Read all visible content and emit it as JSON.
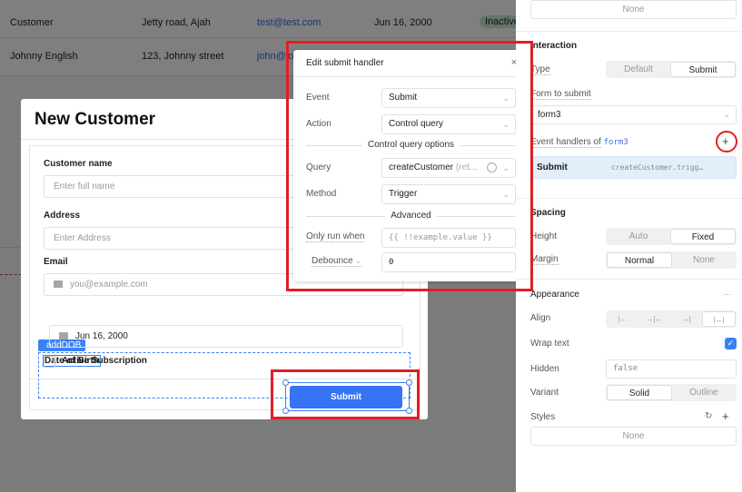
{
  "background_table": {
    "rows": [
      {
        "name": "Customer",
        "address": "Jetty road, Ajah",
        "email": "test@test.com",
        "dob": "Jun 16, 2000",
        "status": "Inactive"
      },
      {
        "name": "Johnny English",
        "address": "123, Johnny street",
        "email": "john@jo",
        "dob": "",
        "status": ""
      }
    ]
  },
  "modal": {
    "title": "New Customer",
    "fields": {
      "customer_name": {
        "label": "Customer name",
        "placeholder": "Enter full name"
      },
      "address": {
        "label": "Address",
        "placeholder": "Enter Address"
      },
      "email": {
        "label": "Email",
        "placeholder": "you@example.com"
      },
      "dob": {
        "tag": "addDOB",
        "label": "Date of Birth",
        "value": "Jun 16, 2000"
      },
      "active": {
        "label": "Active Subscription",
        "checked": false
      }
    },
    "submit_label": "Submit"
  },
  "popover": {
    "title": "Edit submit handler",
    "close": "×",
    "event": {
      "label": "Event",
      "value": "Submit"
    },
    "action": {
      "label": "Action",
      "value": "Control query"
    },
    "control_section": "Control query options",
    "query": {
      "label": "Query",
      "value": "createCustomer",
      "suffix": "(ret..."
    },
    "method": {
      "label": "Method",
      "value": "Trigger"
    },
    "advanced_section": "Advanced",
    "only_run_when": {
      "label": "Only run when",
      "placeholder": "{{ !!example.value }}"
    },
    "debounce": {
      "label": "Debounce",
      "value": "0"
    }
  },
  "panel": {
    "top_box": "None",
    "interaction": {
      "title": "Interaction",
      "type_label": "Type",
      "type_options": [
        "Default",
        "Submit"
      ],
      "type_selected": "Submit",
      "form_label": "Form to submit",
      "form_value": "form3",
      "handlers_label": "Event handlers of",
      "handlers_form": "form3",
      "handler": {
        "event": "Submit",
        "query": "createCustomer.trigg…"
      }
    },
    "spacing": {
      "title": "Spacing",
      "height_label": "Height",
      "height_options": [
        "Auto",
        "Fixed"
      ],
      "height_selected": "Fixed",
      "margin_label": "Margin",
      "margin_options": [
        "Normal",
        "None"
      ],
      "margin_selected": "Normal"
    },
    "appearance": {
      "title": "Appearance",
      "more": "···",
      "align_label": "Align",
      "align_options": [
        "|←",
        "→|←",
        "→|",
        "|↔|"
      ],
      "wrap_label": "Wrap text",
      "wrap_checked": true,
      "hidden_label": "Hidden",
      "hidden_value": "false",
      "variant_label": "Variant",
      "variant_options": [
        "Solid",
        "Outline"
      ],
      "variant_selected": "Solid",
      "styles_label": "Styles",
      "styles_value": "None"
    }
  },
  "colors": {
    "accent": "#3673f5",
    "annotation": "#e01e26",
    "status_inactive": "#24784d"
  }
}
